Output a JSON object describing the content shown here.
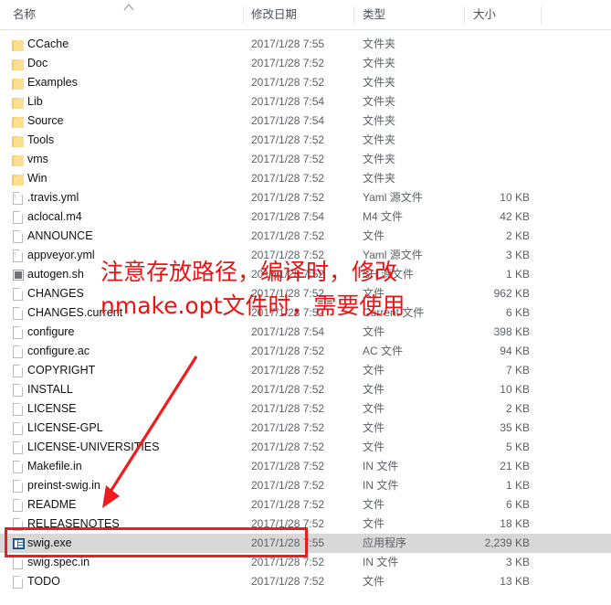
{
  "columns": {
    "name": "名称",
    "date_modified": "修改日期",
    "type": "类型",
    "size": "大小",
    "sort_indicator": "ascending-chevron"
  },
  "rows": [
    {
      "name": "CCache",
      "date": "2017/1/28 7:55",
      "type": "文件夹",
      "size": "",
      "icon": "folder-icon",
      "selected": false
    },
    {
      "name": "Doc",
      "date": "2017/1/28 7:52",
      "type": "文件夹",
      "size": "",
      "icon": "folder-icon",
      "selected": false
    },
    {
      "name": "Examples",
      "date": "2017/1/28 7:52",
      "type": "文件夹",
      "size": "",
      "icon": "folder-icon",
      "selected": false
    },
    {
      "name": "Lib",
      "date": "2017/1/28 7:54",
      "type": "文件夹",
      "size": "",
      "icon": "folder-icon",
      "selected": false
    },
    {
      "name": "Source",
      "date": "2017/1/28 7:54",
      "type": "文件夹",
      "size": "",
      "icon": "folder-icon",
      "selected": false
    },
    {
      "name": "Tools",
      "date": "2017/1/28 7:52",
      "type": "文件夹",
      "size": "",
      "icon": "folder-icon",
      "selected": false
    },
    {
      "name": "vms",
      "date": "2017/1/28 7:52",
      "type": "文件夹",
      "size": "",
      "icon": "folder-icon",
      "selected": false
    },
    {
      "name": "Win",
      "date": "2017/1/28 7:52",
      "type": "文件夹",
      "size": "",
      "icon": "folder-icon",
      "selected": false
    },
    {
      "name": ".travis.yml",
      "date": "2017/1/28 7:52",
      "type": "Yaml 源文件",
      "size": "10 KB",
      "icon": "yaml-file-icon",
      "selected": false
    },
    {
      "name": "aclocal.m4",
      "date": "2017/1/28 7:54",
      "type": "M4 文件",
      "size": "42 KB",
      "icon": "document-icon",
      "selected": false
    },
    {
      "name": "ANNOUNCE",
      "date": "2017/1/28 7:52",
      "type": "文件",
      "size": "2 KB",
      "icon": "document-icon",
      "selected": false
    },
    {
      "name": "appveyor.yml",
      "date": "2017/1/28 7:52",
      "type": "Yaml 源文件",
      "size": "3 KB",
      "icon": "yaml-file-icon",
      "selected": false
    },
    {
      "name": "autogen.sh",
      "date": "2017/1/28 7:52",
      "type": "SH 源文件",
      "size": "1 KB",
      "icon": "script-file-icon",
      "selected": false
    },
    {
      "name": "CHANGES",
      "date": "2017/1/28 7:52",
      "type": "文件",
      "size": "962 KB",
      "icon": "document-icon",
      "selected": false
    },
    {
      "name": "CHANGES.current",
      "date": "2017/1/28 7:52",
      "type": "Current 文件",
      "size": "6 KB",
      "icon": "document-icon",
      "selected": false
    },
    {
      "name": "configure",
      "date": "2017/1/28 7:54",
      "type": "文件",
      "size": "398 KB",
      "icon": "document-icon",
      "selected": false
    },
    {
      "name": "configure.ac",
      "date": "2017/1/28 7:52",
      "type": "AC 文件",
      "size": "94 KB",
      "icon": "document-icon",
      "selected": false
    },
    {
      "name": "COPYRIGHT",
      "date": "2017/1/28 7:52",
      "type": "文件",
      "size": "7 KB",
      "icon": "document-icon",
      "selected": false
    },
    {
      "name": "INSTALL",
      "date": "2017/1/28 7:52",
      "type": "文件",
      "size": "10 KB",
      "icon": "document-icon",
      "selected": false
    },
    {
      "name": "LICENSE",
      "date": "2017/1/28 7:52",
      "type": "文件",
      "size": "2 KB",
      "icon": "document-icon",
      "selected": false
    },
    {
      "name": "LICENSE-GPL",
      "date": "2017/1/28 7:52",
      "type": "文件",
      "size": "35 KB",
      "icon": "document-icon",
      "selected": false
    },
    {
      "name": "LICENSE-UNIVERSITIES",
      "date": "2017/1/28 7:52",
      "type": "文件",
      "size": "5 KB",
      "icon": "document-icon",
      "selected": false
    },
    {
      "name": "Makefile.in",
      "date": "2017/1/28 7:52",
      "type": "IN 文件",
      "size": "21 KB",
      "icon": "document-icon",
      "selected": false
    },
    {
      "name": "preinst-swig.in",
      "date": "2017/1/28 7:52",
      "type": "IN 文件",
      "size": "1 KB",
      "icon": "document-icon",
      "selected": false
    },
    {
      "name": "README",
      "date": "2017/1/28 7:52",
      "type": "文件",
      "size": "6 KB",
      "icon": "document-icon",
      "selected": false
    },
    {
      "name": "RELEASENOTES",
      "date": "2017/1/28 7:52",
      "type": "文件",
      "size": "18 KB",
      "icon": "document-icon",
      "selected": false
    },
    {
      "name": "swig.exe",
      "date": "2017/1/28 7:55",
      "type": "应用程序",
      "size": "2,239 KB",
      "icon": "application-icon",
      "selected": true
    },
    {
      "name": "swig.spec.in",
      "date": "2017/1/28 7:52",
      "type": "IN 文件",
      "size": "3 KB",
      "icon": "document-icon",
      "selected": false
    },
    {
      "name": "TODO",
      "date": "2017/1/28 7:52",
      "type": "文件",
      "size": "13 KB",
      "icon": "document-icon",
      "selected": false
    }
  ],
  "annotations": {
    "line1": "注意存放路径，编译时，修改",
    "line2": "nmake.opt文件时，需要使用",
    "color": "#ef1111",
    "arrow": "red-arrow-pointing-to-swig-exe",
    "highlight": "red-rectangle-around-swig-exe"
  }
}
